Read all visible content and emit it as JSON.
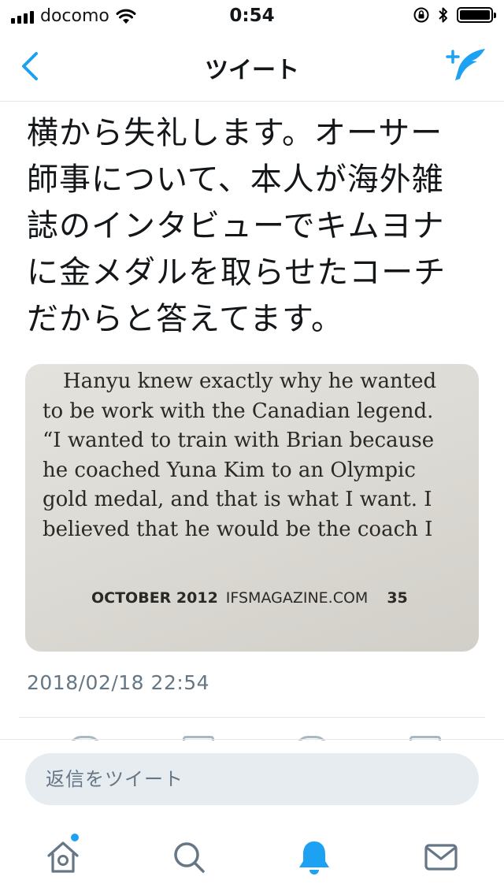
{
  "status_bar": {
    "carrier": "docomo",
    "time": "0:54"
  },
  "nav": {
    "title": "ツイート",
    "back_icon": "chevron-left-icon",
    "compose_icon": "compose-tweet-icon"
  },
  "tweet": {
    "text": "横から失礼します。オーサー\n師事について、本人が海外雑\n誌のインタビューでキムヨナ\nに金メダルを取らせたコーチ\nだからと答えてます。",
    "photo": {
      "lines": [
        "Hanyu knew exactly why he wanted",
        "to be work with the Canadian legend.",
        "“I wanted to train with Brian because",
        "he coached Yuna Kim to an Olympic",
        "gold medal, and that is what I want. I",
        "believed that he would be the coach I"
      ],
      "footer_month": "OCTOBER 2012",
      "footer_site": "IFSMAGAZINE.COM",
      "footer_page": "35"
    },
    "timestamp": "2018/02/18 22:54"
  },
  "reply": {
    "placeholder": "返信をツイート"
  },
  "tabbar": {
    "items": [
      {
        "name": "home",
        "icon": "home-icon",
        "active": false,
        "has_badge": true
      },
      {
        "name": "search",
        "icon": "search-icon",
        "active": false
      },
      {
        "name": "notifications",
        "icon": "bell-icon",
        "active": true
      },
      {
        "name": "messages",
        "icon": "envelope-icon",
        "active": false
      }
    ]
  },
  "colors": {
    "accent": "#1da1f2",
    "text": "#14171a",
    "secondary_text": "#657786",
    "divider": "#e1e8ed",
    "reply_bg": "#e6ecf0"
  }
}
